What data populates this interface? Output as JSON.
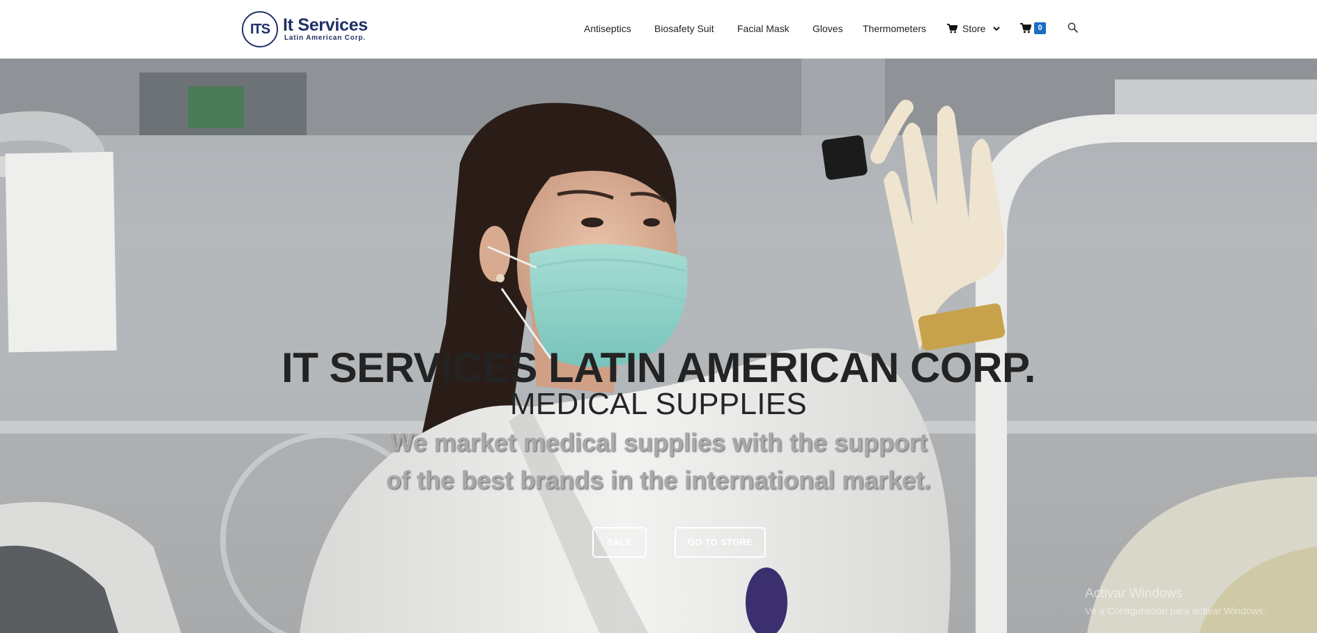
{
  "header": {
    "logo": {
      "mark": "ITS",
      "name": "It Services",
      "subtitle": "Latin American Corp."
    },
    "nav": [
      {
        "label": "Antiseptics"
      },
      {
        "label": "Biosafety Suit"
      },
      {
        "label": "Facial Mask"
      },
      {
        "label": "Gloves"
      },
      {
        "label": "Thermometers"
      }
    ],
    "store": {
      "label": "Store",
      "icon": "cart-icon",
      "dropdown_icon": "chevron-down-icon"
    },
    "cart": {
      "icon": "cart-icon",
      "count": "0"
    },
    "search": {
      "icon": "search-icon"
    }
  },
  "hero": {
    "title": "IT SERVICES LATIN AMERICAN CORP.",
    "subtitle": "MEDICAL SUPPLIES",
    "description": "We market medical supplies with the support of the best brands in the international market.",
    "buttons": [
      {
        "label": "SALE"
      },
      {
        "label": "GO TO STORE"
      }
    ]
  },
  "watermark": {
    "title": "Activar Windows",
    "subtitle": "Ve a Configuración para activar Windows."
  },
  "colors": {
    "brand": "#1f3067",
    "cart_badge": "#1a6ec4",
    "title_text": "#232323"
  }
}
